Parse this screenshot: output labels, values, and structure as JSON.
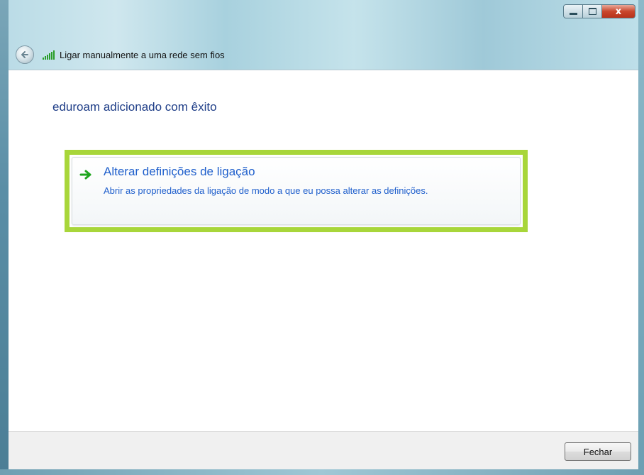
{
  "window": {
    "close_glyph": "x",
    "colors": {
      "accent_link": "#1f5fcc",
      "heading": "#1e3d87",
      "highlight_border": "#a8d63a",
      "arrow_green": "#1ea51e"
    }
  },
  "nav": {
    "title": "Ligar manualmente a uma rede sem fios",
    "back_icon": "back-arrow-icon",
    "network_icon": "wireless-signal-icon"
  },
  "main": {
    "heading": "eduroam adicionado com êxito",
    "option": {
      "icon": "green-arrow-icon",
      "title": "Alterar definições de ligação",
      "description": "Abrir as propriedades da ligação de modo a que eu possa alterar as definições."
    }
  },
  "footer": {
    "close_label": "Fechar"
  }
}
